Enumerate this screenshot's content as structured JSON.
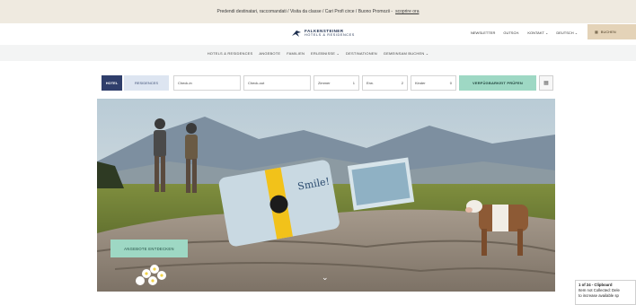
{
  "announcement": {
    "text": "Predendi destinatari, raccomandati / Visita da classe / Cari Profi circe / Buono Promozii -",
    "link": "scoprire ora"
  },
  "brand": {
    "name": "FALKENSTEINER",
    "tagline": "HOTELS & RESIDENCES"
  },
  "top_links": [
    "NEWSLETTER",
    "GUTSCH.",
    "KONTAKT ⌄",
    "DEUTSCH ⌄"
  ],
  "book_button": {
    "icon": "calendar-icon",
    "label": "BUCHEN"
  },
  "main_nav": [
    "HOTELS & RESIDENCES",
    "ANGEBOTE",
    "FAMILIEN",
    "ERLEBNISSE ⌄",
    "DESTINATIONEN",
    "GEMEINSAM BUCHEN ⌄"
  ],
  "booking_bar": {
    "hotel_tab": "HOTEL",
    "residence_tab": "RESIDENCES",
    "checkin_placeholder": "Check-in",
    "checkout_placeholder": "Check-out",
    "rooms_label": "Zimmer",
    "rooms_value": "1",
    "adults_label": "Erw.",
    "adults_value": "2",
    "children_label": "Kinder",
    "children_value": "0",
    "search_button": "VERFÜGBARKEIT PRÜFEN",
    "calendar_icon": "calendar-icon"
  },
  "hero": {
    "cta": "ANGEBOTE ENTDECKEN",
    "scroll_icon": "chevron-down-icon",
    "image_text": "Smile!"
  },
  "clipboard_widget": {
    "title": "1 of 24 - Clipboard",
    "line1": "Item not Collected: Dele",
    "line2": "to increase available sp"
  }
}
